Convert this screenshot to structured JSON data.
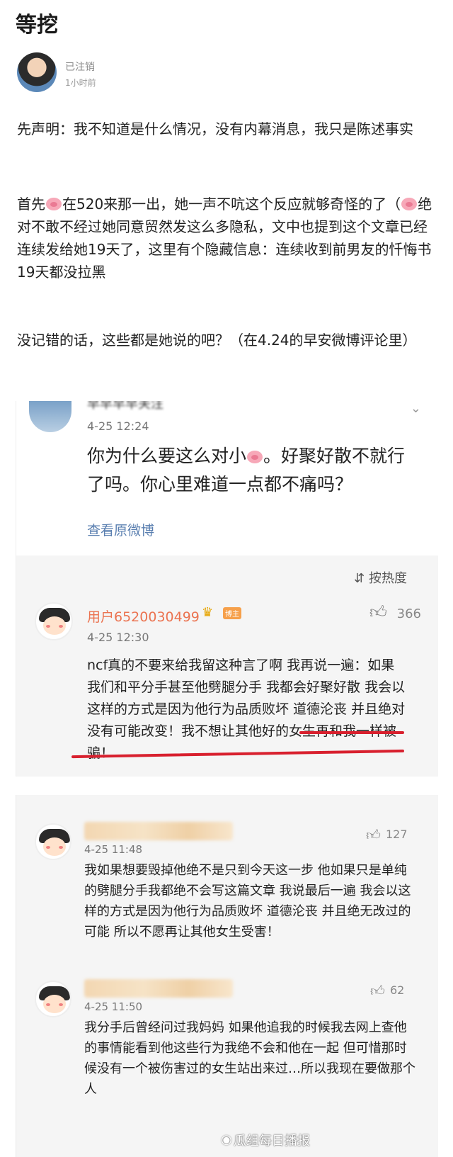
{
  "post": {
    "title": "等挖",
    "author": "已注销",
    "time": "1小时前",
    "p1": "先声明：我不知道是什么情况，没有内幕消息，我只是陈述事实",
    "p2a": "首先",
    "p2b": "在520来那一出，她一声不吭这个反应就够奇怪的了（",
    "p2c": "绝对不敢不经过她同意贸然发这么多隐私，文中也提到这个文章已经连续发给她19天了，这里有个隐藏信息：连续收到前男友的忏悔书19天都没拉黑",
    "p3": "没记错的话，这些都是她说的吧？（在4.24的早安微博评论里）"
  },
  "shot1": {
    "top_user_name": "早早早早关注",
    "top_time": "4-25 12:24",
    "content_a": "你为什么要这么对小",
    "content_b": "。好聚好散不就行了吗。你心里难道一点都不痛吗？",
    "view_original": "查看原微博",
    "sort_label": "按热度",
    "comment": {
      "name": "用户6520030499",
      "badge": "博主",
      "likes": "366",
      "time": "4-25 12:30",
      "text": "ncf真的不要来给我留这种言了啊 我再说一遍：如果我们和平分手甚至他劈腿分手 我都会好聚好散 我会以这样的方式是因为他行为品质败坏 道德沦丧 并且绝对没有可能改变！我不想让其他好的女生再和我一样被骗！"
    }
  },
  "shot2": {
    "comments": [
      {
        "likes": "127",
        "time": "4-25 11:48",
        "text": "我如果想要毁掉他绝不是只到今天这一步 他如果只是单纯的劈腿分手我都绝不会写这篇文章 我说最后一遍 我会以这样的方式是因为他行为品质败坏 道德沦丧 并且绝无改过的可能 所以不愿再让其他女生受害！"
      },
      {
        "likes": "62",
        "time": "4-25 11:50",
        "text": "我分手后曾经问过我妈妈 如果他追我的时候我去网上查他的事情能看到他这些行为我绝不会和他在一起 但可惜那时候没有一个被伤害过的女生站出来过…所以我现在要做那个人"
      }
    ]
  },
  "watermark": "瓜组每日播报",
  "colors": {
    "username": "#eb7350",
    "link": "#5a7fb0",
    "underline": "#d8202e"
  },
  "icons": {
    "like": "thumbs-up-icon",
    "sort": "sort-icon",
    "chevron": "chevron-down-icon",
    "crown": "crown-icon",
    "pig": "pig-emoji-icon"
  }
}
